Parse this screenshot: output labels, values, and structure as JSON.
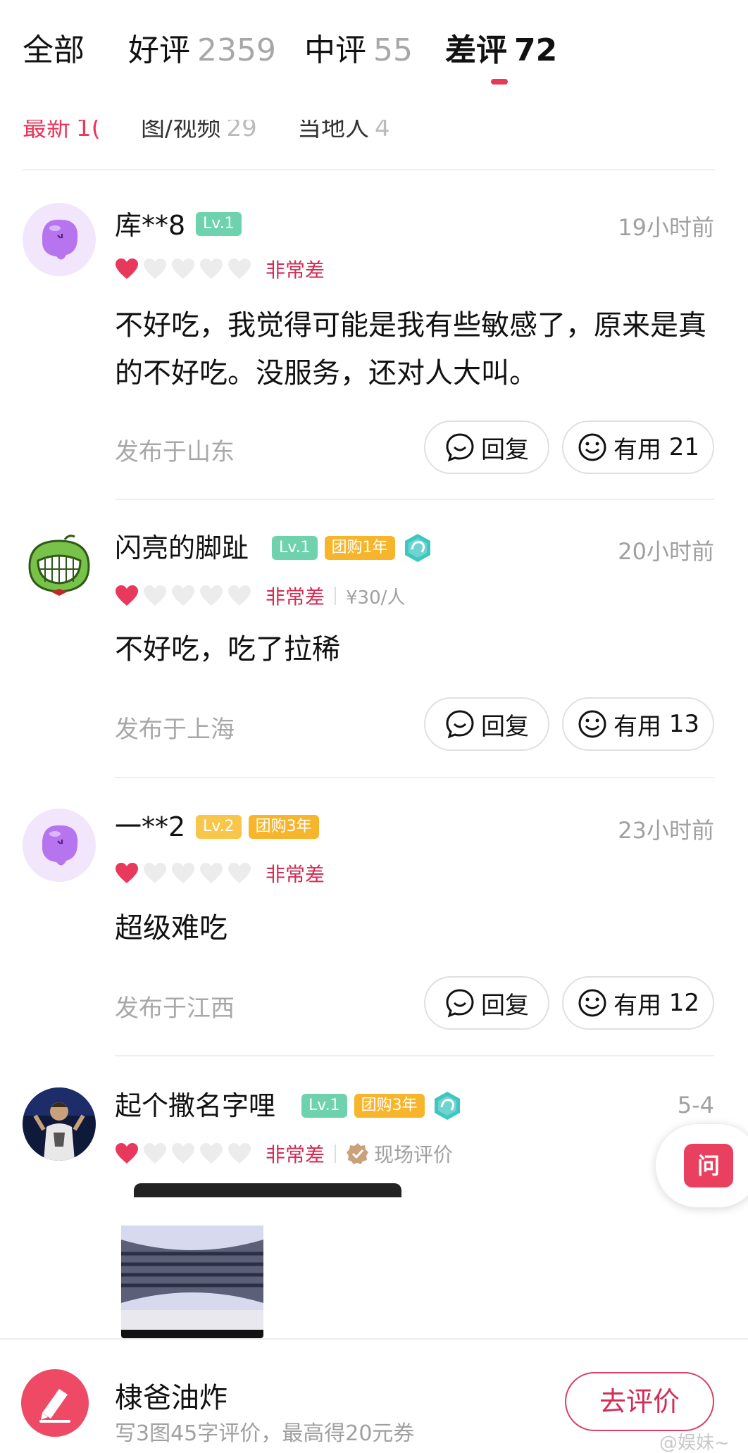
{
  "tabs": [
    {
      "label": "全部",
      "count": ""
    },
    {
      "label": "好评",
      "count": "2359"
    },
    {
      "label": "中评",
      "count": "55"
    },
    {
      "label": "差评",
      "count": "72"
    }
  ],
  "active_tab_index": 3,
  "subfilters": [
    {
      "label": "最新",
      "count": "1("
    },
    {
      "label": "图/视频",
      "count": "29"
    },
    {
      "label": "当地人",
      "count": "4"
    }
  ],
  "reviews": [
    {
      "username": "库**8",
      "level": "Lv.1",
      "group_badge": "",
      "time": "19小时前",
      "rating_text": "非常差",
      "hearts_filled": 1,
      "hearts_total": 5,
      "price": "",
      "content": "不好吃，我觉得可能是我有些敏感了，原来是真的不好吃。没服务，还对人大叫。",
      "location": "发布于山东",
      "reply_label": "回复",
      "useful_label": "有用",
      "useful_count": "21",
      "avatar_icon": "purple-blob-avatar"
    },
    {
      "username": "闪亮的脚趾",
      "level": "Lv.1",
      "group_badge": "团购1年",
      "time": "20小时前",
      "rating_text": "非常差",
      "hearts_filled": 1,
      "hearts_total": 5,
      "price": "¥30/人",
      "content": "不好吃，吃了拉稀",
      "location": "发布于上海",
      "reply_label": "回复",
      "useful_label": "有用",
      "useful_count": "13",
      "avatar_icon": "green-grin-avatar"
    },
    {
      "username": "一**2",
      "level": "Lv.2",
      "group_badge": "团购3年",
      "time": "23小时前",
      "rating_text": "非常差",
      "hearts_filled": 1,
      "hearts_total": 5,
      "price": "",
      "content": "超级难吃",
      "location": "发布于江西",
      "reply_label": "回复",
      "useful_label": "有用",
      "useful_count": "12",
      "avatar_icon": "purple-blob-avatar"
    },
    {
      "username": "起个撒名字哩",
      "level": "Lv.1",
      "group_badge": "团购3年",
      "time": "5-4",
      "rating_text": "非常差",
      "hearts_filled": 1,
      "hearts_total": 5,
      "verified_label": "现场评价",
      "avatar_icon": "person-photo-avatar"
    }
  ],
  "ask_button": {
    "label": "问"
  },
  "bottom_bar": {
    "shop_name": "棣爸油炸",
    "hint": "写3图45字评价，最高得20元券",
    "write_button": "去评价",
    "watermark": "@娱妹~"
  },
  "colors": {
    "accent": "#e8385c",
    "heart": "#e8385c",
    "muted": "#a0a0a0",
    "lv1": "#6fd2ae",
    "lv2": "#f7c64a",
    "group": "#f7b52b"
  }
}
